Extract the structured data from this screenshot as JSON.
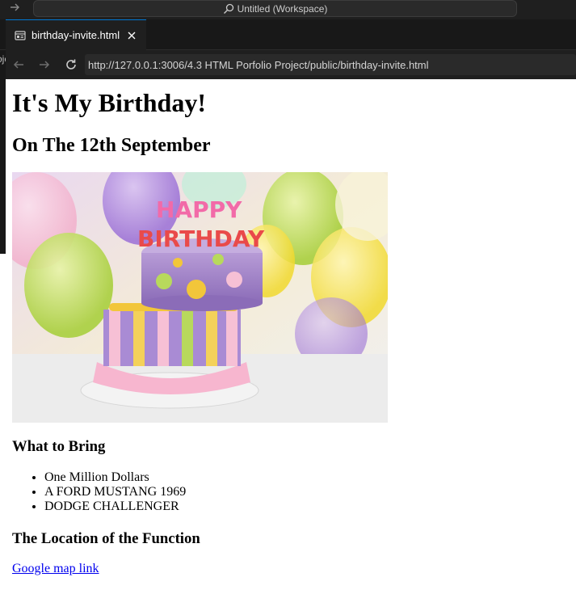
{
  "window": {
    "title": "Untitled (Workspace)"
  },
  "tab": {
    "label": "birthday-invite.html"
  },
  "browser": {
    "url": "http://127.0.0.1:3006/4.3 HTML Porfolio Project/public/birthday-invite.html"
  },
  "sidebar_fragment": "oje",
  "page": {
    "heading": "It's My Birthday!",
    "subheading": "On The 12th September",
    "image_text": {
      "line1": "HAPPY",
      "line2": "BIRTHDAY"
    },
    "bring_heading": "What to Bring",
    "bring_items": [
      "One Million Dollars",
      "A FORD MUSTANG 1969",
      "DODGE CHALLENGER"
    ],
    "location_heading": "The Location of the Function",
    "map_link": "Google map link"
  },
  "colors": {
    "accent": "#0078d4",
    "link": "#0000ee",
    "titlebar": "#1f1f1f"
  }
}
